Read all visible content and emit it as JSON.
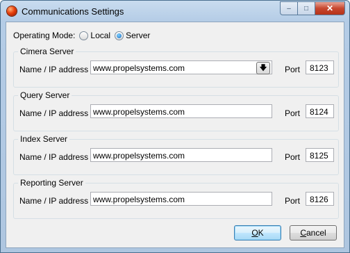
{
  "window": {
    "title": "Communications Settings"
  },
  "caption": {
    "minimize": "–",
    "maximize": "□",
    "close": "✕"
  },
  "operating_mode": {
    "label": "Operating Mode:",
    "options": [
      {
        "label": "Local",
        "selected": false
      },
      {
        "label": "Server",
        "selected": true
      }
    ]
  },
  "groups": [
    {
      "title": "Cimera Server",
      "field_label": "Name / IP address",
      "address": "www.propelsystems.com",
      "port_label": "Port",
      "port": "8123"
    },
    {
      "title": "Query Server",
      "field_label": "Name / IP address",
      "address": "www.propelsystems.com",
      "port_label": "Port",
      "port": "8124"
    },
    {
      "title": "Index Server",
      "field_label": "Name / IP address",
      "address": "www.propelsystems.com",
      "port_label": "Port",
      "port": "8125"
    },
    {
      "title": "Reporting Server",
      "field_label": "Name / IP address",
      "address": "www.propelsystems.com",
      "port_label": "Port",
      "port": "8126"
    }
  ],
  "buttons": {
    "ok_underline": "O",
    "ok_rest": "K",
    "cancel_underline": "C",
    "cancel_rest": "ancel"
  }
}
